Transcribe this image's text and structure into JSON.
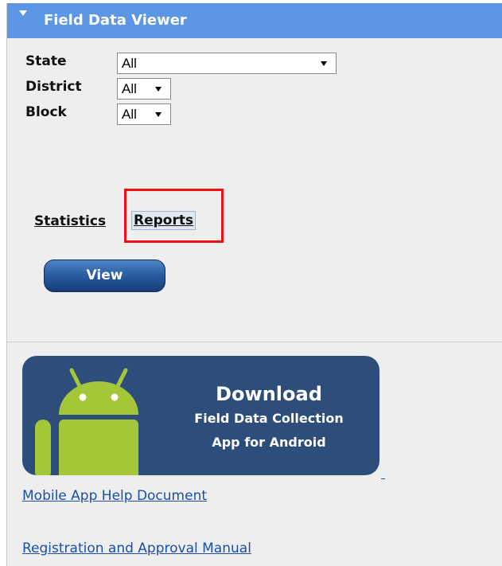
{
  "panel": {
    "title": "Field Data Viewer",
    "header_color": "#5e96e6"
  },
  "filters": [
    {
      "label": "State",
      "value": "All"
    },
    {
      "label": "District",
      "value": "All"
    },
    {
      "label": "Block",
      "value": "All"
    }
  ],
  "tabs": [
    {
      "label": "Statistics",
      "selected": false
    },
    {
      "label": "Reports",
      "selected": true,
      "highlighted": true
    }
  ],
  "actions": {
    "view_label": "View"
  },
  "banner": {
    "title": "Download",
    "line1": "Field Data Collection",
    "line2": "App for Android",
    "icon": "android-icon",
    "background": "#2d4d7b"
  },
  "links": [
    {
      "text": "Mobile App Help Document"
    },
    {
      "text": "Registration and Approval Manual"
    }
  ],
  "colors": {
    "highlight": "#ee1111",
    "link": "#1a4faa"
  }
}
